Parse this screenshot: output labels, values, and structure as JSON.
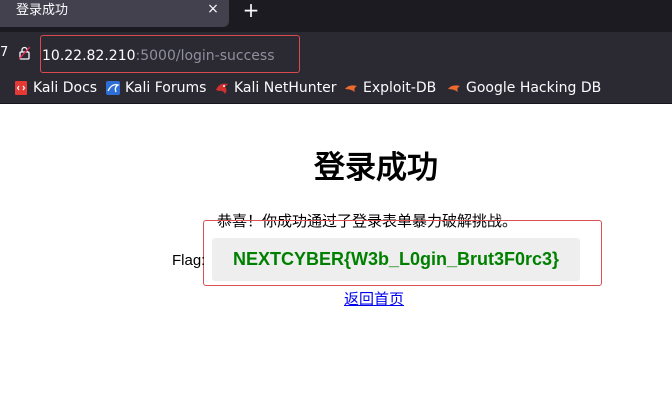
{
  "tab": {
    "title": "登录成功",
    "close_glyph": "×",
    "new_tab_glyph": "+"
  },
  "nav": {
    "left_edge_glyph": "7"
  },
  "url": {
    "host": "10.22.82.210",
    "path": ":5000/login-success"
  },
  "bookmarks": [
    {
      "label": "Kali Docs",
      "icon": "kali-docs-icon"
    },
    {
      "label": "Kali Forums",
      "icon": "kali-forums-icon"
    },
    {
      "label": "Kali NetHunter",
      "icon": "kali-nethunter-icon"
    },
    {
      "label": "Exploit-DB",
      "icon": "exploit-db-icon"
    },
    {
      "label": "Google Hacking DB",
      "icon": "ghdb-icon"
    }
  ],
  "page": {
    "title": "登录成功",
    "message": "恭喜！你成功通过了登录表单暴力破解挑战。",
    "flag_label": "Flag:",
    "flag_value": "NEXTCYBER{W3b_L0gin_Brut3F0rc3}",
    "back_link": "返回首页"
  },
  "colors": {
    "highlight_border": "#dc5054",
    "flag_text": "#008000",
    "link": "#0000ee"
  }
}
